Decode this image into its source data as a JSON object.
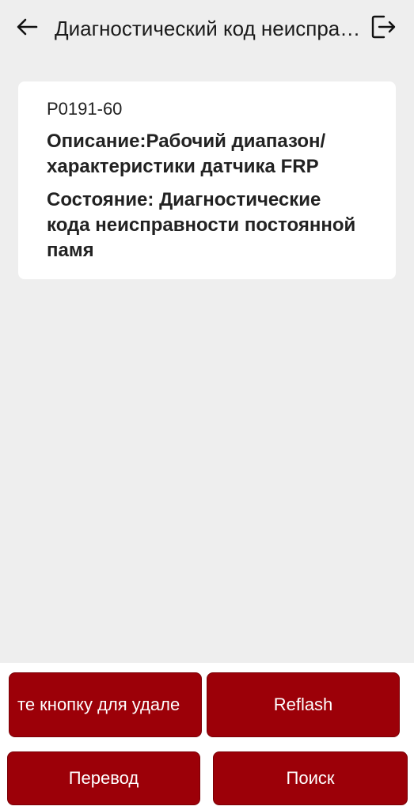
{
  "header": {
    "title": "Диагностический код неисправности",
    "back_icon": "arrow-left-icon",
    "exit_icon": "exit-icon"
  },
  "dtc": {
    "code": "P0191-60",
    "description_label": "Описание:",
    "description_value": "Рабочий диапазон/характеристики датчика FRP",
    "state_label": "Состояние:",
    "state_value": "Диагностические кода неисправности постоянной памя"
  },
  "buttons": {
    "delete_label": "те кнопку для удале",
    "reflash_label": "Reflash",
    "translate_label": "Перевод",
    "search_label": "Поиск"
  },
  "colors": {
    "accent": "#9c0008",
    "background": "#eeeeee"
  }
}
